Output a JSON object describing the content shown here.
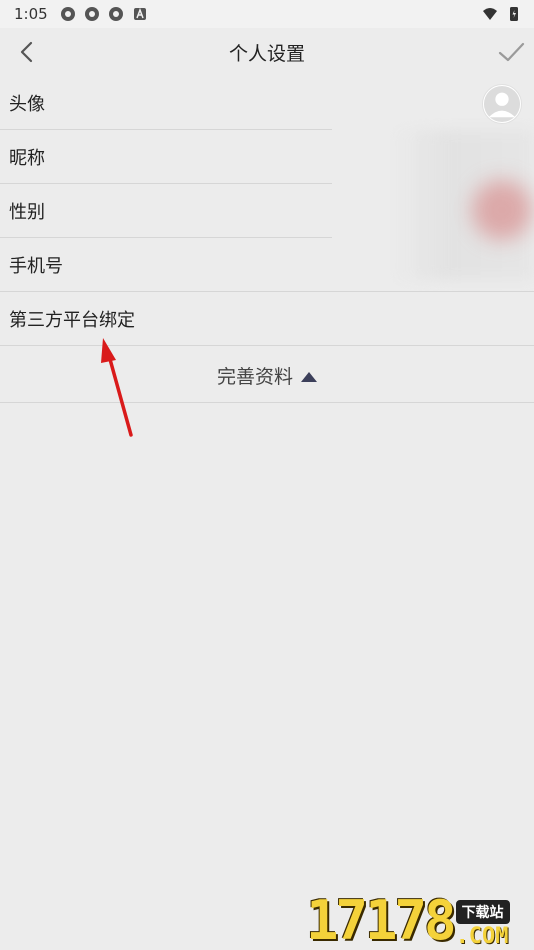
{
  "status_bar": {
    "time": "1:05",
    "left_icons": [
      "aperture-icon",
      "aperture-icon",
      "aperture-icon",
      "a-badge-icon"
    ],
    "right_icons": [
      "wifi-icon",
      "battery-icon"
    ]
  },
  "header": {
    "title": "个人设置",
    "back_icon": "chevron-left-icon",
    "confirm_icon": "check-icon"
  },
  "settings": {
    "items": [
      {
        "label": "头像"
      },
      {
        "label": "昵称"
      },
      {
        "label": "性别"
      },
      {
        "label": "手机号"
      },
      {
        "label": "第三方平台绑定"
      }
    ]
  },
  "expand": {
    "label": "完善资料",
    "icon": "triangle-up-icon"
  },
  "watermark": {
    "digits": "17178",
    "badge": "下载站",
    "suffix": ".COM"
  },
  "colors": {
    "background": "#ececec",
    "annotation_arrow": "#d91a1a",
    "watermark_yellow": "#f4d23a"
  }
}
